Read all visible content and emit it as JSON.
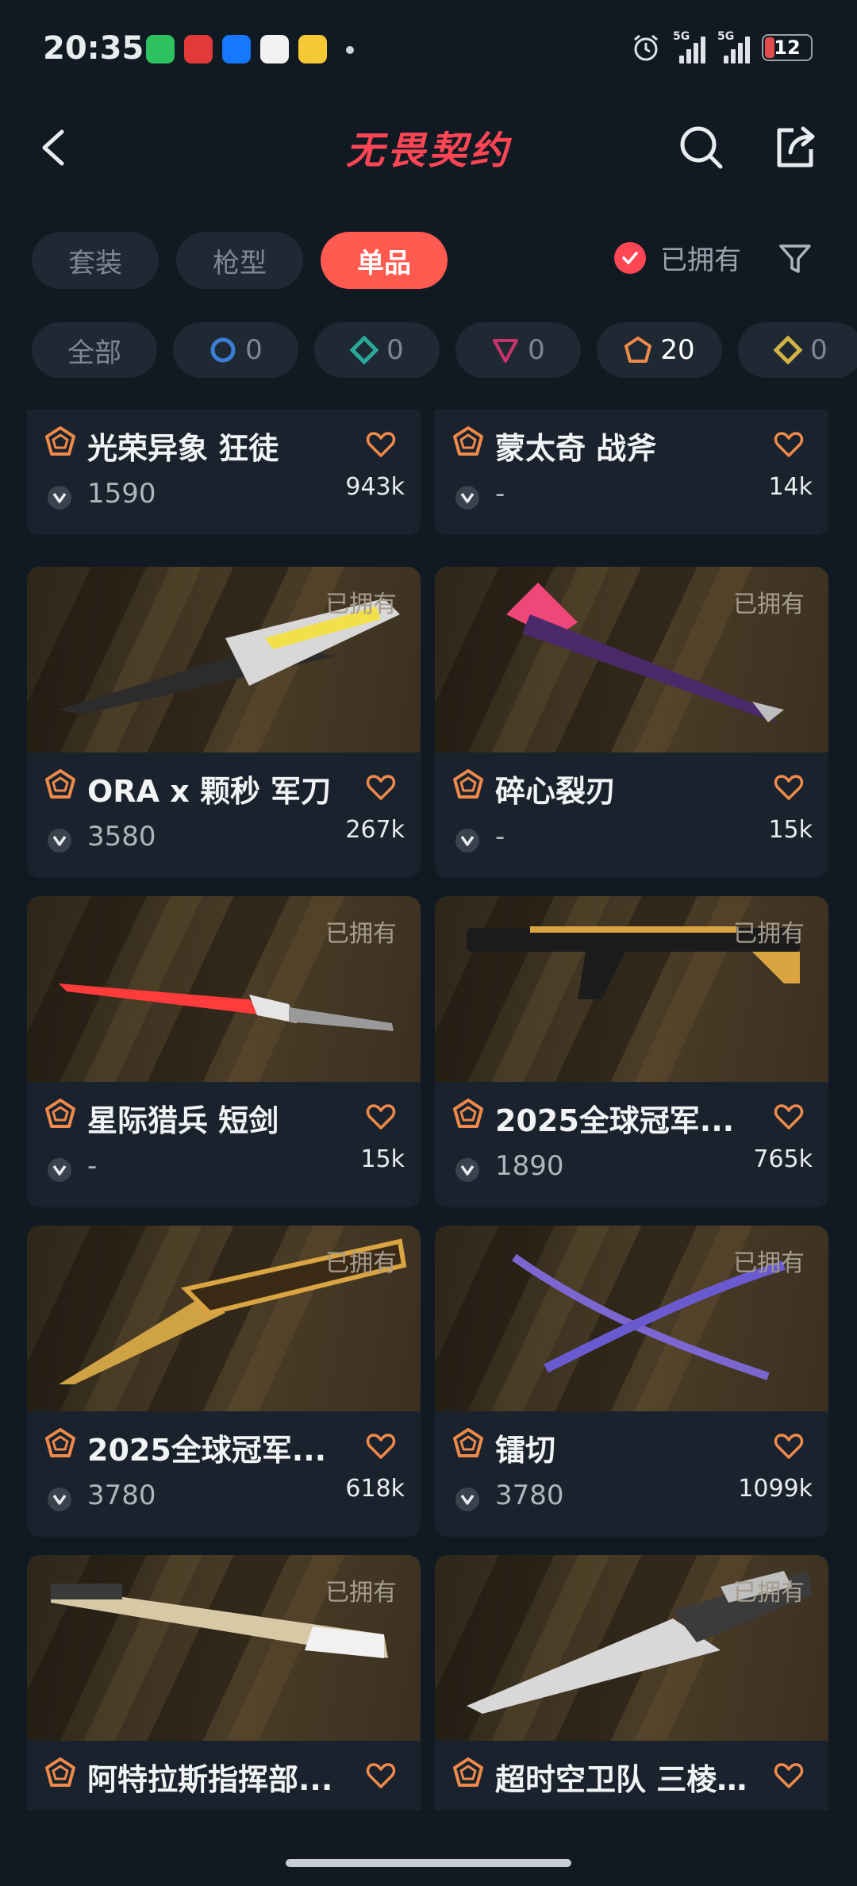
{
  "status_bar": {
    "time": "20:35",
    "battery": "12",
    "signal1": "5G",
    "signal2": "5G"
  },
  "header": {
    "logo": "无畏契约"
  },
  "tabs": [
    {
      "label": "套装"
    },
    {
      "label": "枪型"
    },
    {
      "label": "单品",
      "active": true
    }
  ],
  "owned_filter": {
    "label": "已拥有",
    "checked": true
  },
  "tiers": [
    {
      "label": "全部"
    },
    {
      "count": "0",
      "color": "#3c7ed6",
      "shape": "circle"
    },
    {
      "count": "0",
      "color": "#2aa899",
      "shape": "diamond"
    },
    {
      "count": "0",
      "color": "#c8336e",
      "shape": "triangle"
    },
    {
      "count": "20",
      "color": "#f08a4b",
      "shape": "pentagon"
    },
    {
      "count": "0",
      "color": "#d2b445",
      "shape": "diamond"
    }
  ],
  "owned_tag": "已拥有",
  "items": [
    {
      "name": "光荣异象 狂徒",
      "price": "1590",
      "likes": "943k",
      "owned": false
    },
    {
      "name": "蒙太奇 战斧",
      "price": "-",
      "likes": "14k",
      "owned": false
    },
    {
      "name": "ORA x 颗秒 军刀",
      "price": "3580",
      "likes": "267k",
      "owned": true
    },
    {
      "name": "碎心裂刃",
      "price": "-",
      "likes": "15k",
      "owned": true
    },
    {
      "name": "星际猎兵 短剑",
      "price": "-",
      "likes": "15k",
      "owned": true
    },
    {
      "name": "2025全球冠军...",
      "price": "1890",
      "likes": "765k",
      "owned": true
    },
    {
      "name": "2025全球冠军...",
      "price": "3780",
      "likes": "618k",
      "owned": true
    },
    {
      "name": "镭切",
      "price": "3780",
      "likes": "1099k",
      "owned": true
    },
    {
      "name": "阿特拉斯指挥部...",
      "price": "",
      "likes": "",
      "owned": true
    },
    {
      "name": "超时空卫队 三棱...",
      "price": "",
      "likes": "",
      "owned": true
    }
  ],
  "colors": {
    "accent": "#ff4655",
    "tab_active": "#ff5a4f",
    "tier_premium": "#f08a4b",
    "background": "#111922",
    "card": "#1a232d"
  }
}
